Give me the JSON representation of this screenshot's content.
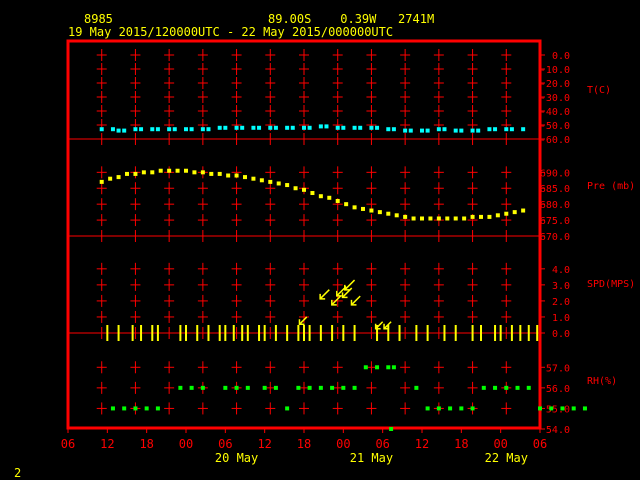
{
  "header": {
    "station": "8985",
    "location": "89.00S    0.39W   2741M",
    "period": "19 May 2015/120000UTC - 22 May 2015/000000UTC",
    "page_number": "2"
  },
  "colors": {
    "background": "#000000",
    "frame": "#ff0000",
    "axis_text": "#ff0000",
    "header_text": "#ffff00",
    "date_text": "#ffff00",
    "temperature": "#00ffff",
    "pressure": "#ffff00",
    "wind": "#ffff00",
    "humidity": "#00ff00"
  },
  "chart_data": {
    "type": "scatter",
    "x_ticks": [
      "06",
      "12",
      "18",
      "00",
      "06",
      "12",
      "18",
      "00",
      "06",
      "12",
      "18",
      "00",
      "06"
    ],
    "date_labels": [
      {
        "label": "20 May",
        "x": 36
      },
      {
        "label": "21 May",
        "x": 60
      },
      {
        "label": "22 May",
        "x": 84
      }
    ],
    "xlim": [
      6,
      90
    ],
    "panels": [
      {
        "key": "temperature",
        "label": "T(C)",
        "ticks": [
          "0.0",
          "-10.0",
          "-20.0",
          "-30.0",
          "-40.0",
          "-50.0",
          "-60.0"
        ],
        "ylim": [
          -60,
          0
        ],
        "x": [
          12,
          14,
          15,
          16,
          18,
          19,
          21,
          22,
          24,
          25,
          27,
          28,
          30,
          31,
          33,
          34,
          36,
          37,
          39,
          40,
          42,
          43,
          45,
          46,
          48,
          49,
          51,
          52,
          54,
          55,
          57,
          58,
          60,
          61,
          63,
          64,
          66,
          67,
          69,
          70,
          72,
          73,
          75,
          76,
          78,
          79,
          81,
          82,
          84,
          85,
          87
        ],
        "values": [
          -53,
          -53,
          -54,
          -54,
          -53,
          -53,
          -53,
          -53,
          -53,
          -53,
          -53,
          -53,
          -53,
          -53,
          -52,
          -52,
          -52,
          -52,
          -52,
          -52,
          -52,
          -52,
          -52,
          -52,
          -52,
          -52,
          -51,
          -51,
          -52,
          -52,
          -52,
          -52,
          -52,
          -52,
          -53,
          -53,
          -54,
          -54,
          -54,
          -54,
          -53,
          -53,
          -54,
          -54,
          -54,
          -54,
          -53,
          -53,
          -53,
          -53,
          -53
        ]
      },
      {
        "key": "pressure",
        "label": "Pre (mb)",
        "ticks": [
          "690.0",
          "685.0",
          "680.0",
          "675.0",
          "670.0"
        ],
        "ylim": [
          670,
          694.5
        ],
        "x": [
          12,
          13.5,
          15,
          16.5,
          18,
          19.5,
          21,
          22.5,
          24,
          25.5,
          27,
          28.5,
          30,
          31.5,
          33,
          34.5,
          36,
          37.5,
          39,
          40.5,
          42,
          43.5,
          45,
          46.5,
          48,
          49.5,
          51,
          52.5,
          54,
          55.5,
          57,
          58.5,
          60,
          61.5,
          63,
          64.5,
          66,
          67.5,
          69,
          70.5,
          72,
          73.5,
          75,
          76.5,
          78,
          79.5,
          81,
          82.5,
          84,
          85.5,
          87
        ],
        "values": [
          687,
          688,
          688.5,
          689.5,
          689.5,
          690,
          690,
          690.5,
          690.5,
          690.5,
          690.5,
          690,
          690,
          689.5,
          689.5,
          689,
          689,
          688.5,
          688,
          687.5,
          687,
          686.5,
          686,
          685,
          684.5,
          683.5,
          682.5,
          682,
          681,
          680,
          679,
          678.5,
          678,
          677.5,
          677,
          676.5,
          676,
          675.5,
          675.5,
          675.5,
          675.5,
          675.5,
          675.5,
          675.5,
          676,
          676,
          676,
          676.5,
          677,
          677.5,
          678
        ]
      },
      {
        "key": "wind",
        "label": "SPD(MPS)",
        "ticks": [
          "4.0",
          "3.0",
          "2.0",
          "1.0",
          "0.0"
        ],
        "ylim": [
          0,
          4.8
        ],
        "wind_calm_times": [
          13,
          15,
          17.5,
          19,
          21,
          22,
          26,
          27,
          29,
          31,
          33,
          34,
          35.5,
          37,
          38,
          40,
          41,
          43,
          45,
          47,
          48,
          49,
          51,
          53,
          55,
          57,
          61,
          63,
          65,
          68,
          70,
          73,
          75,
          78,
          79.5,
          82,
          83,
          85,
          86.5,
          88,
          89.5
        ],
        "x": [
          48.5,
          52.5,
          54.5,
          55.5,
          57,
          56.5,
          58,
          62,
          63.5
        ],
        "values": [
          1.0,
          2.7,
          2.3,
          2.9,
          3.3,
          2.8,
          2.3,
          0.7,
          0.7
        ]
      },
      {
        "key": "humidity",
        "label": "RH(%)",
        "ticks": [
          "57.0",
          "56.0",
          "55.0",
          "54.0"
        ],
        "ylim": [
          54,
          57.5
        ],
        "x": [
          14,
          16,
          18,
          20,
          22,
          26,
          28,
          30,
          34,
          36,
          38,
          41,
          43,
          45,
          47,
          49,
          51,
          53,
          55,
          57,
          59,
          61,
          63,
          64,
          68,
          70,
          72,
          74,
          76,
          78,
          80,
          82,
          84,
          86,
          88,
          90,
          92,
          94,
          96,
          98
        ],
        "values": [
          55,
          55,
          55,
          55,
          55,
          56,
          56,
          56,
          56,
          56,
          56,
          56,
          56,
          55,
          56,
          56,
          56,
          56,
          56,
          56,
          57,
          57,
          57,
          57,
          56,
          55,
          55,
          55,
          55,
          55,
          56,
          56,
          56,
          56,
          56,
          55,
          55,
          55,
          55,
          55
        ],
        "off_chart_x": [
          63.5
        ],
        "off_chart_values": [
          54
        ]
      }
    ]
  }
}
